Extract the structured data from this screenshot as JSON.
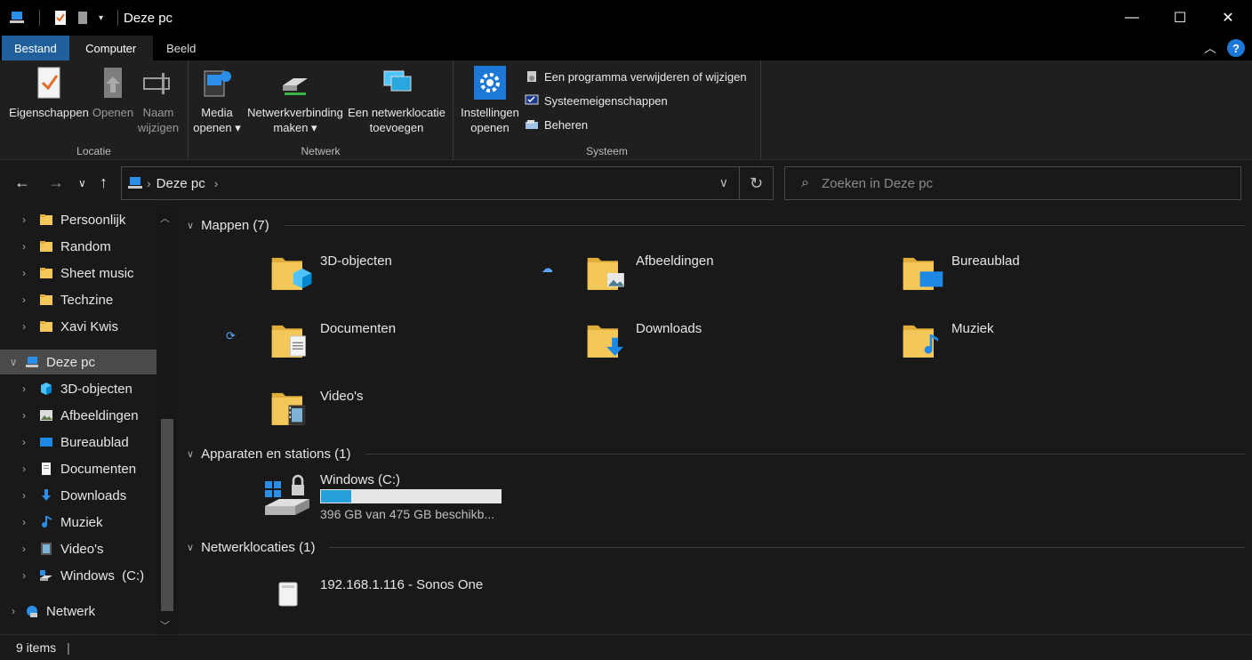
{
  "window": {
    "title": "Deze pc",
    "controls": {
      "minimize": "—",
      "maximize": "☐",
      "close": "✕"
    }
  },
  "ribbon_tabs": [
    "Bestand",
    "Computer",
    "Beeld"
  ],
  "ribbon": {
    "locatie": {
      "label": "Locatie",
      "buttons": [
        "Eigenschappen",
        "Openen",
        "Naam\nwijzigen"
      ]
    },
    "netwerk": {
      "label": "Netwerk",
      "buttons": [
        "Media\nopenen ▾",
        "Netwerkverbinding\nmaken ▾",
        "Een netwerklocatie\ntoevoegen"
      ]
    },
    "systeem": {
      "label": "Systeem",
      "big_button": "Instellingen\nopenen",
      "small_buttons": [
        "Een programma verwijderen of wijzigen",
        "Systeemeigenschappen",
        "Beheren"
      ]
    }
  },
  "address": {
    "path": "Deze pc",
    "search_placeholder": "Zoeken in Deze pc"
  },
  "nav": {
    "items": [
      {
        "label": "Persoonlijk",
        "icon": "folder-icon"
      },
      {
        "label": "Random",
        "icon": "folder-icon"
      },
      {
        "label": "Sheet music",
        "icon": "folder-icon"
      },
      {
        "label": "Techzine",
        "icon": "folder-icon"
      },
      {
        "label": "Xavi Kwis",
        "icon": "folder-icon"
      },
      {
        "label": "Deze pc",
        "icon": "computer-icon",
        "selected": true
      },
      {
        "label": "3D-objecten",
        "icon": "cube-icon"
      },
      {
        "label": "Afbeeldingen",
        "icon": "picture-icon"
      },
      {
        "label": "Bureaublad",
        "icon": "desktop-icon"
      },
      {
        "label": "Documenten",
        "icon": "document-icon"
      },
      {
        "label": "Downloads",
        "icon": "download-icon"
      },
      {
        "label": "Muziek",
        "icon": "music-icon"
      },
      {
        "label": "Video's",
        "icon": "video-icon"
      },
      {
        "label": "Windows  (C:)",
        "icon": "drive-icon"
      },
      {
        "label": "Netwerk",
        "icon": "network-icon"
      }
    ]
  },
  "content": {
    "sections": {
      "mappen": "Mappen (7)",
      "apparaten": "Apparaten en stations (1)",
      "netwerk": "Netwerklocaties (1)"
    },
    "folders": [
      {
        "name": "3D-objecten",
        "overlay": "cube"
      },
      {
        "name": "Afbeeldingen",
        "overlay": "picture",
        "status": "cloud"
      },
      {
        "name": "Bureaublad",
        "overlay": "desktop"
      },
      {
        "name": "Documenten",
        "overlay": "document",
        "status": "sync"
      },
      {
        "name": "Downloads",
        "overlay": "download"
      },
      {
        "name": "Muziek",
        "overlay": "music"
      },
      {
        "name": "Video's",
        "overlay": "video"
      }
    ],
    "drive": {
      "name": "Windows  (C:)",
      "free_text": "396 GB van 475 GB beschikb...",
      "used_fraction": 0.17
    },
    "network_location": "192.168.1.116 - Sonos One"
  },
  "statusbar": {
    "items": "9 items",
    "separator": "|"
  },
  "colors": {
    "accent": "#1f5f9c",
    "progress": "#26a0da",
    "folder": "#f3c75a"
  }
}
